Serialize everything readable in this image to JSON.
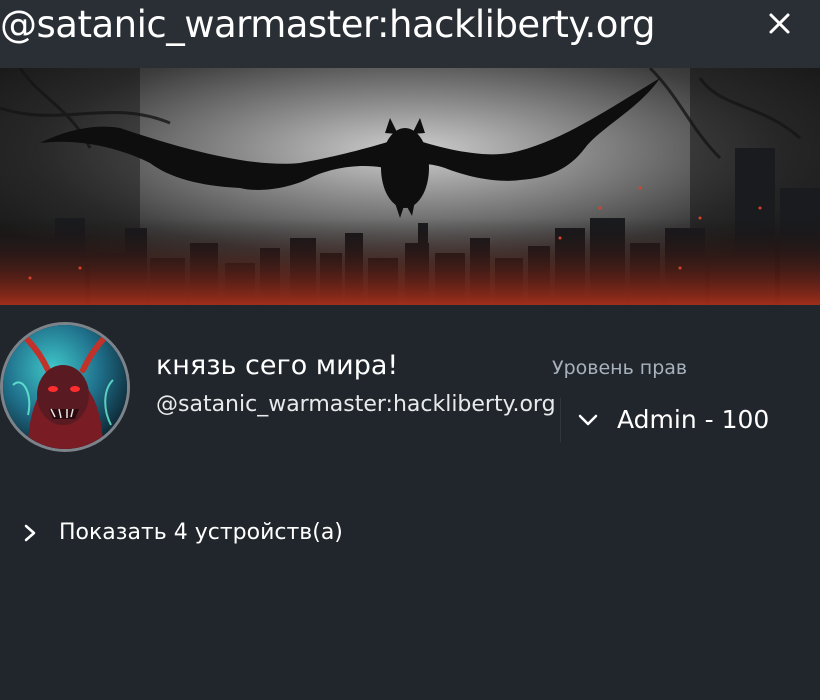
{
  "header": {
    "title": "@satanic_warmaster:hackliberty.org",
    "close_icon": "close-icon"
  },
  "banner": {
    "image": "dark-bat-city-banner"
  },
  "profile": {
    "avatar": "demon-avatar",
    "display_name": "князь сего мира!",
    "user_id": "@satanic_warmaster:hackliberty.org"
  },
  "power_level": {
    "label": "Уровень прав",
    "selected": "Admin - 100",
    "icon": "chevron-down-icon"
  },
  "devices": {
    "label": "Показать 4 устройств(а)",
    "icon": "chevron-right-icon"
  },
  "colors": {
    "background": "#21262c",
    "header_background": "#2a2f36",
    "text_primary": "#ffffff",
    "text_secondary": "#a9b2bc"
  }
}
